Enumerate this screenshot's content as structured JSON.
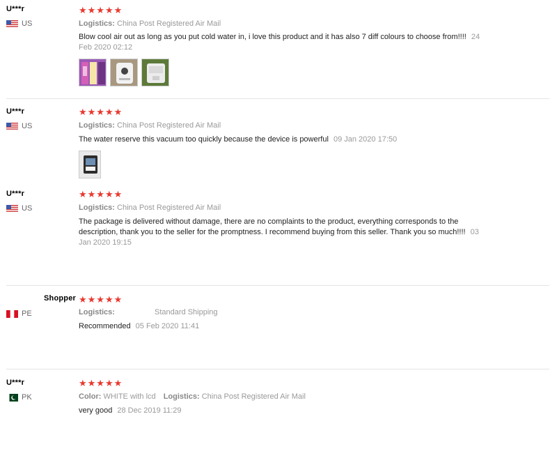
{
  "reviews": [
    {
      "user": "U***r",
      "country": "US",
      "stars": "★★★★★",
      "logistics_label": "Logistics:",
      "logistics_value": "China Post Registered Air Mail",
      "text": "Blow cool air out as long as you put cold water in, i love this product and it has also 7 diff colours to choose from!!!!",
      "date": "24 Feb 2020 02:12"
    },
    {
      "user": "U***r",
      "country": "US",
      "stars": "★★★★★",
      "logistics_label": "Logistics:",
      "logistics_value": "China Post Registered Air Mail",
      "text": "The water reserve this vacuum too quickly because the device is powerful",
      "date": "09 Jan 2020 17:50"
    },
    {
      "user": "U***r",
      "country": "US",
      "stars": "★★★★★",
      "logistics_label": "Logistics:",
      "logistics_value": "China Post Registered Air Mail",
      "text": "The package is delivered without damage, there are no complaints to the product, everything corresponds to the description, thank you to the seller for the promptness. I recommend buying from this seller. Thank you so much!!!!",
      "date": "03 Jan 2020 19:15"
    },
    {
      "user": "Shopper",
      "country": "PE",
      "stars": "★★★★★",
      "logistics_label": "Logistics:",
      "logistics_value": "Standard Shipping",
      "text": "Recommended",
      "date": "05 Feb 2020 11:41"
    },
    {
      "user": "U***r",
      "country": "PK",
      "stars": "★★★★★",
      "color_label": "Color:",
      "color_value": "WHITE with lcd",
      "logistics_label": "Logistics:",
      "logistics_value": "China Post Registered Air Mail",
      "text": "very good",
      "date": "28 Dec 2019 11:29"
    }
  ],
  "rating": {
    "max": 5,
    "values": [
      5,
      5,
      5,
      5,
      5
    ]
  },
  "colors": {
    "star": "#e8382e",
    "divider": "#e5e5e5",
    "meta": "#999999"
  },
  "icons": [
    "us-flag-icon",
    "pe-flag-icon",
    "pk-flag-icon",
    "review-photo-thumbnail"
  ]
}
